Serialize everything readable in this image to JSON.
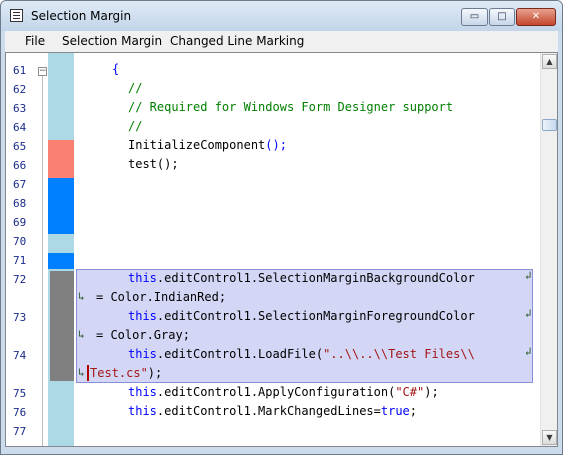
{
  "window": {
    "title": "Selection Margin"
  },
  "titlebar_buttons": {
    "minimize": "▭",
    "maximize": "□",
    "close": "✕"
  },
  "menu": [
    "File",
    "Selection Margin",
    "Changed Line Marking"
  ],
  "scrollbar": {
    "up_arrow": "▲",
    "down_arrow": "▼"
  },
  "fold_marker": "−",
  "wrap_glyphs": {
    "end": "↲",
    "start": "↳"
  },
  "line_numbers": [
    "61",
    "62",
    "63",
    "64",
    "65",
    "66",
    "67",
    "68",
    "69",
    "70",
    "71",
    "72",
    "73",
    "74",
    "75",
    "76",
    "77"
  ],
  "code": {
    "l61": "{",
    "l62": "//",
    "l63": "// Required for Windows Form Designer support",
    "l64": "//",
    "l65_name": "InitializeComponent",
    "l65_punct": "();",
    "l66": "test();",
    "l72_kw": "this",
    "l72_rest": ".editControl1.SelectionMarginBackgroundColor",
    "l72b": "= Color.IndianRed;",
    "l73_kw": "this",
    "l73_rest": ".editControl1.SelectionMarginForegroundColor",
    "l73b": "= Color.Gray;",
    "l74_kw": "this",
    "l74_rest": ".editControl1.LoadFile(",
    "l74_str": "\"..\\\\..\\\\Test Files\\\\",
    "l74b_str": "Test.cs\"",
    "l74b_rest": ");",
    "l75_kw": "this",
    "l75_rest": ".editControl1.ApplyConfiguration(",
    "l75_str": "\"C#\"",
    "l75_end": ");",
    "l76_kw": "this",
    "l76_rest": ".editControl1.MarkChangedLines=",
    "l76_kw2": "true",
    "l76_end": ";"
  },
  "colors": {
    "selection_margin": "#add8e6",
    "changed_line_mark": "#fa8072",
    "saved_line_mark": "#0080ff",
    "selected_line_margin": "#808080"
  }
}
